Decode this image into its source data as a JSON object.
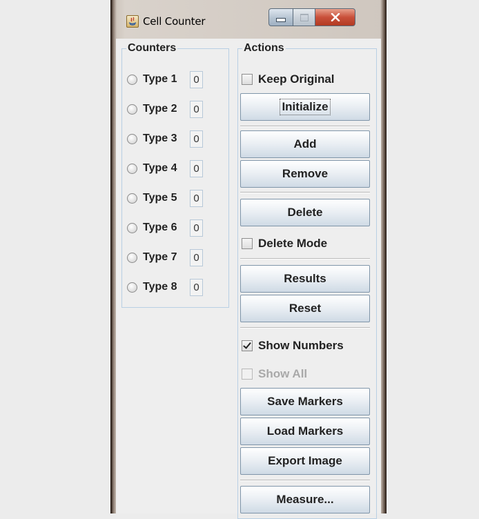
{
  "window": {
    "title": "Cell Counter",
    "controls": {
      "minimize": "minimize-icon",
      "maximize": "maximize-icon",
      "close": "close-icon"
    }
  },
  "counters": {
    "legend": "Counters",
    "types": [
      {
        "label": "Type 1",
        "count": "0"
      },
      {
        "label": "Type 2",
        "count": "0"
      },
      {
        "label": "Type 3",
        "count": "0"
      },
      {
        "label": "Type 4",
        "count": "0"
      },
      {
        "label": "Type 5",
        "count": "0"
      },
      {
        "label": "Type 6",
        "count": "0"
      },
      {
        "label": "Type 7",
        "count": "0"
      },
      {
        "label": "Type 8",
        "count": "0"
      }
    ]
  },
  "actions": {
    "legend": "Actions",
    "keep_original": {
      "label": "Keep Original",
      "checked": false
    },
    "initialize": "Initialize",
    "add": "Add",
    "remove": "Remove",
    "delete": "Delete",
    "delete_mode": {
      "label": "Delete Mode",
      "checked": false
    },
    "results": "Results",
    "reset": "Reset",
    "show_numbers": {
      "label": "Show Numbers",
      "checked": true
    },
    "show_all": {
      "label": "Show All",
      "checked": false,
      "enabled": false
    },
    "save_markers": "Save Markers",
    "load_markers": "Load Markers",
    "export_image": "Export Image",
    "measure": "Measure..."
  }
}
